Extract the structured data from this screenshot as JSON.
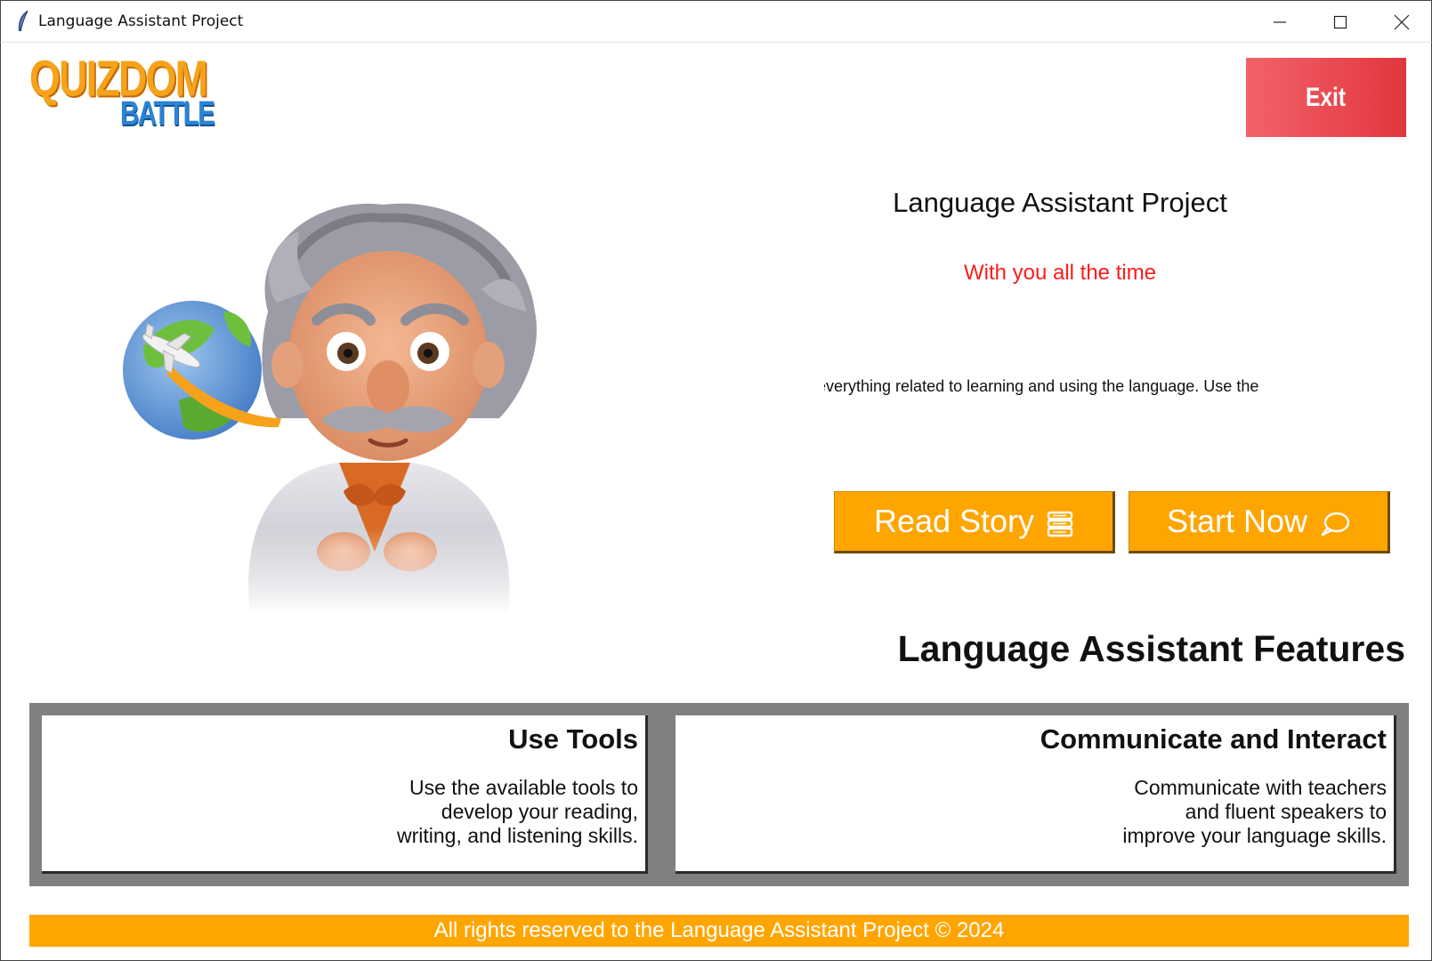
{
  "window": {
    "title": "Language Assistant Project",
    "icon": "feather-icon",
    "controls": [
      "minimize-icon",
      "maximize-icon",
      "close-icon"
    ]
  },
  "logo": {
    "line1": "QUIZDOM",
    "line2": "BATTLE"
  },
  "header": {
    "exit_label": "Exit"
  },
  "hero": {
    "title": "Language Assistant Project",
    "subtitle": "With you all the time",
    "ticker_text": "everything related to learning and using the language. Use the"
  },
  "actions": {
    "read_story_label": "Read Story",
    "read_story_icon": "book-stack-icon",
    "start_now_label": "Start Now",
    "start_now_icon": "chat-bubble-icon"
  },
  "features": {
    "heading": "Language Assistant Features",
    "cards": [
      {
        "title": "Use Tools",
        "description": "Use the available tools to\ndevelop your reading,\nwriting, and listening skills."
      },
      {
        "title": "Communicate and Interact",
        "description": "Communicate with teachers\nand fluent speakers to\nimprove your language skills."
      }
    ]
  },
  "footer": {
    "text": "All rights reserved to the Language Assistant Project © 2024"
  },
  "colors": {
    "accent_orange": "#ffa500",
    "exit_red": "#e2363d",
    "subtitle_red": "#ff1a1a",
    "panel_gray": "#808080"
  }
}
